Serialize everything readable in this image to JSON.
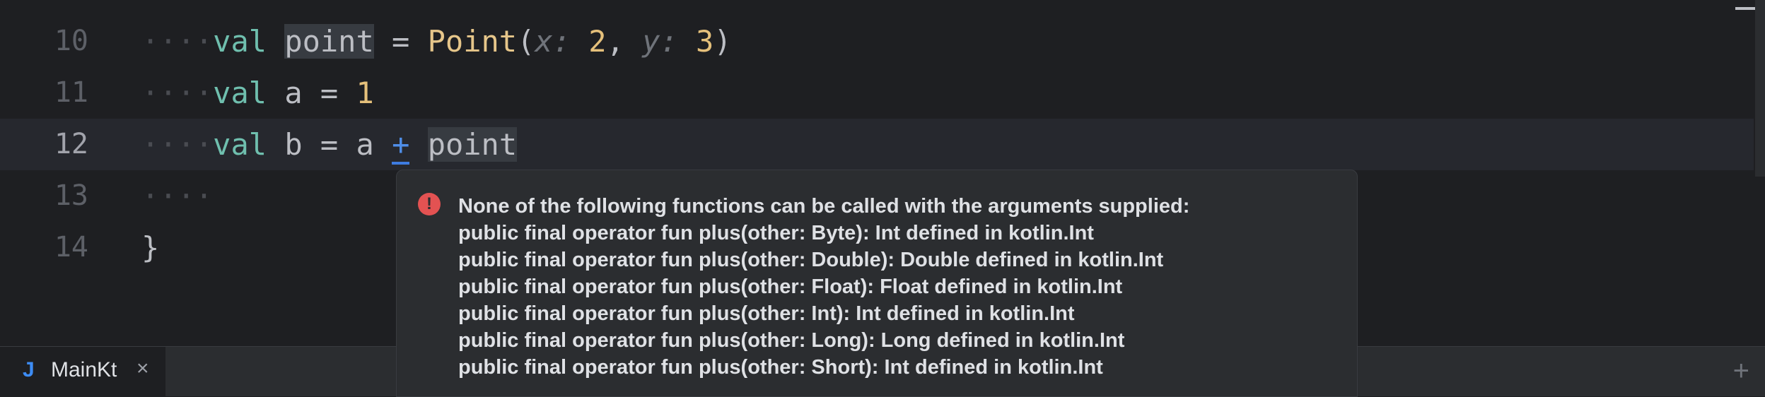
{
  "editor": {
    "lines": [
      {
        "number": "10",
        "indent": "····",
        "keyword": "val",
        "name": "point",
        "eq": "=",
        "call": "Point",
        "hint_x": "x:",
        "arg1": "2",
        "comma": ",",
        "hint_y": "y:",
        "arg2": "3",
        "close": ")"
      },
      {
        "number": "11",
        "indent": "····",
        "keyword": "val",
        "name": "a",
        "eq": "=",
        "value": "1"
      },
      {
        "number": "12",
        "indent": "····",
        "keyword": "val",
        "name": "b",
        "eq": "=",
        "left": "a",
        "op": "+",
        "right": "point"
      },
      {
        "number": "13",
        "indent": "····"
      },
      {
        "number": "14",
        "brace": "}"
      }
    ]
  },
  "popup": {
    "error_icon": "exclamation-circle-icon",
    "lines": [
      "None of the following functions can be called with the arguments supplied:",
      "public final operator fun plus(other: Byte): Int defined in kotlin.Int",
      "public final operator fun plus(other: Double): Double defined in kotlin.Int",
      "public final operator fun plus(other: Float): Float defined in kotlin.Int",
      "public final operator fun plus(other: Int): Int defined in kotlin.Int",
      "public final operator fun plus(other: Long): Long defined in kotlin.Int",
      "public final operator fun plus(other: Short): Int defined in kotlin.Int"
    ]
  },
  "tabbar": {
    "tab_icon": "J",
    "tab_name": "MainKt",
    "close_glyph": "×",
    "add_glyph": "+"
  },
  "colors": {
    "background": "#1e1f22",
    "keyword": "#6fbfae",
    "number": "#e5c07b",
    "error": "#e35252",
    "accent": "#3e7ce0"
  }
}
